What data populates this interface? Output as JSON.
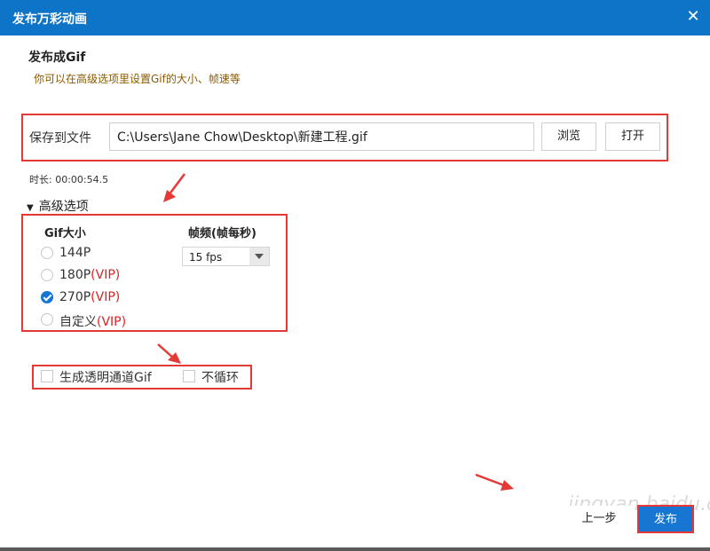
{
  "window": {
    "title": "发布万彩动画"
  },
  "header": {
    "heading": "发布成Gif",
    "subheading": "你可以在高级选项里设置Gif的大小、帧速等"
  },
  "save": {
    "label": "保存到文件",
    "path_value": "C:\\Users\\Jane Chow\\Desktop\\新建工程.gif",
    "browse_label": "浏览",
    "open_label": "打开"
  },
  "duration": "时长: 00:00:54.5",
  "advanced": {
    "toggle_label": "高级选项",
    "size_header": "Gif大小",
    "fps_header": "帧频(帧每秒)",
    "sizes": [
      {
        "label": "144P",
        "vip": "",
        "checked": false
      },
      {
        "label": "180P",
        "vip": "(VIP)",
        "checked": false
      },
      {
        "label": "270P",
        "vip": "(VIP)",
        "checked": true
      },
      {
        "label": "自定义",
        "vip": "(VIP)",
        "checked": false
      }
    ],
    "fps_value": "15 fps"
  },
  "options": {
    "transparent_label": "生成透明通道Gif",
    "no_loop_label": "不循环"
  },
  "footer": {
    "prev_label": "上一步",
    "publish_label": "发布"
  },
  "watermark": "jingyan.baidu.com"
}
